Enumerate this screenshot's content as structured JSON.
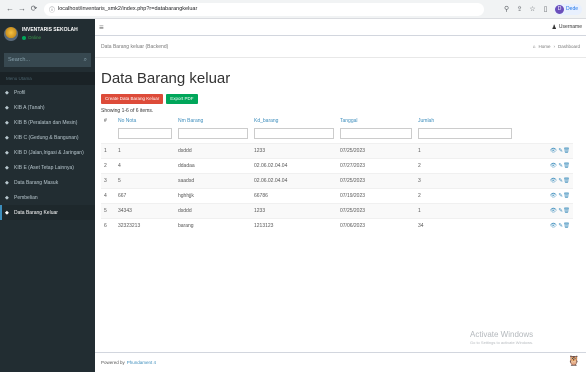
{
  "browser": {
    "back_icon": "arrow-left-icon",
    "forward_icon": "arrow-right-icon",
    "reload_icon": "reload-icon",
    "url": "localhost/inventaris_smk2/index.php?r=databarangkeluar",
    "profile_label": "Dede",
    "profile_initial": "D"
  },
  "sidebar": {
    "app_title": "INVENTARIS SEKOLAH",
    "status": "Online",
    "search_placeholder": "Search...",
    "menu_header": "Menu Utama",
    "items": [
      {
        "label": "Profil",
        "icon": "dashboard-icon"
      },
      {
        "label": "KIB A (Tanah)",
        "icon": "dashboard-icon"
      },
      {
        "label": "KIB B (Peralatan dan Mesin)",
        "icon": "dashboard-icon"
      },
      {
        "label": "KIB C (Gedung & Bangunan)",
        "icon": "dashboard-icon"
      },
      {
        "label": "KIB D (Jalan,Irigasi & Jaringan)",
        "icon": "dashboard-icon"
      },
      {
        "label": "KIB E (Aset Tetap Lainnya)",
        "icon": "dashboard-icon"
      },
      {
        "label": "Data Barang Masuk",
        "icon": "dashboard-icon"
      },
      {
        "label": "Pembelian",
        "icon": "dashboard-icon"
      },
      {
        "label": "Data Barang Keluar",
        "icon": "dashboard-icon",
        "active": true
      }
    ]
  },
  "topbar": {
    "menu_icon": "hamburger-icon",
    "username": "Username"
  },
  "content_header": {
    "subtitle": "Data Barang keluar (Backend)",
    "breadcrumb_home": "Home",
    "breadcrumb_current": "Dashboard"
  },
  "main": {
    "title": "Data Barang keluar",
    "create_button": "Create Data Barang Keluar",
    "export_button": "Export PDF",
    "summary": "Showing 1-6 of 6 items.",
    "columns": [
      "#",
      "No Nota",
      "Nm Barang",
      "Kd_barang",
      "Tanggal",
      "Jumlah"
    ],
    "rows": [
      [
        "1",
        "1",
        "dsddd",
        "1233",
        "07/25/2023",
        "1"
      ],
      [
        "2",
        "4",
        "ddadaa",
        "02.06.02.04.04",
        "07/27/2023",
        "2"
      ],
      [
        "3",
        "5",
        "saadsd",
        "02.06.02.04.04",
        "07/25/2023",
        "3"
      ],
      [
        "4",
        "667",
        "hghhjjk",
        "66786",
        "07/19/2023",
        "2"
      ],
      [
        "5",
        "34343",
        "dsddd",
        "1233",
        "07/25/2023",
        "1"
      ],
      [
        "6",
        "32323213",
        "barang",
        "1213123",
        "07/06/2023",
        "34"
      ]
    ]
  },
  "footer": {
    "text": "Powered by",
    "brand": "Phundament 4"
  },
  "watermark": {
    "title": "Activate Windows",
    "subtitle": "Go to Settings to activate Windows."
  },
  "colors": {
    "sidebar_bg": "#222d32",
    "accent": "#3c8dbc",
    "create_btn": "#dd4b39",
    "export_btn": "#00a65a"
  }
}
